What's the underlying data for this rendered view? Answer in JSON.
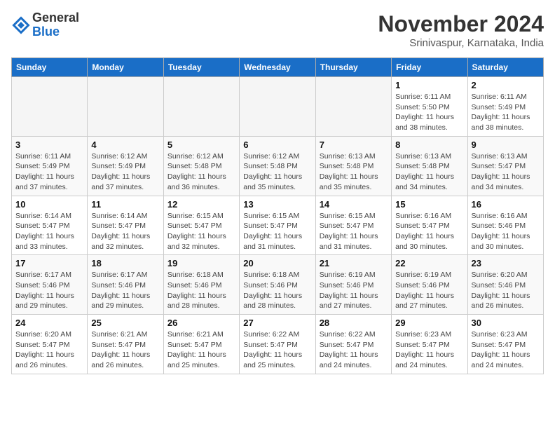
{
  "logo": {
    "general": "General",
    "blue": "Blue"
  },
  "title": "November 2024",
  "location": "Srinivaspur, Karnataka, India",
  "weekdays": [
    "Sunday",
    "Monday",
    "Tuesday",
    "Wednesday",
    "Thursday",
    "Friday",
    "Saturday"
  ],
  "weeks": [
    [
      {
        "day": "",
        "info": ""
      },
      {
        "day": "",
        "info": ""
      },
      {
        "day": "",
        "info": ""
      },
      {
        "day": "",
        "info": ""
      },
      {
        "day": "",
        "info": ""
      },
      {
        "day": "1",
        "info": "Sunrise: 6:11 AM\nSunset: 5:50 PM\nDaylight: 11 hours and 38 minutes."
      },
      {
        "day": "2",
        "info": "Sunrise: 6:11 AM\nSunset: 5:49 PM\nDaylight: 11 hours and 38 minutes."
      }
    ],
    [
      {
        "day": "3",
        "info": "Sunrise: 6:11 AM\nSunset: 5:49 PM\nDaylight: 11 hours and 37 minutes."
      },
      {
        "day": "4",
        "info": "Sunrise: 6:12 AM\nSunset: 5:49 PM\nDaylight: 11 hours and 37 minutes."
      },
      {
        "day": "5",
        "info": "Sunrise: 6:12 AM\nSunset: 5:48 PM\nDaylight: 11 hours and 36 minutes."
      },
      {
        "day": "6",
        "info": "Sunrise: 6:12 AM\nSunset: 5:48 PM\nDaylight: 11 hours and 35 minutes."
      },
      {
        "day": "7",
        "info": "Sunrise: 6:13 AM\nSunset: 5:48 PM\nDaylight: 11 hours and 35 minutes."
      },
      {
        "day": "8",
        "info": "Sunrise: 6:13 AM\nSunset: 5:48 PM\nDaylight: 11 hours and 34 minutes."
      },
      {
        "day": "9",
        "info": "Sunrise: 6:13 AM\nSunset: 5:47 PM\nDaylight: 11 hours and 34 minutes."
      }
    ],
    [
      {
        "day": "10",
        "info": "Sunrise: 6:14 AM\nSunset: 5:47 PM\nDaylight: 11 hours and 33 minutes."
      },
      {
        "day": "11",
        "info": "Sunrise: 6:14 AM\nSunset: 5:47 PM\nDaylight: 11 hours and 32 minutes."
      },
      {
        "day": "12",
        "info": "Sunrise: 6:15 AM\nSunset: 5:47 PM\nDaylight: 11 hours and 32 minutes."
      },
      {
        "day": "13",
        "info": "Sunrise: 6:15 AM\nSunset: 5:47 PM\nDaylight: 11 hours and 31 minutes."
      },
      {
        "day": "14",
        "info": "Sunrise: 6:15 AM\nSunset: 5:47 PM\nDaylight: 11 hours and 31 minutes."
      },
      {
        "day": "15",
        "info": "Sunrise: 6:16 AM\nSunset: 5:47 PM\nDaylight: 11 hours and 30 minutes."
      },
      {
        "day": "16",
        "info": "Sunrise: 6:16 AM\nSunset: 5:46 PM\nDaylight: 11 hours and 30 minutes."
      }
    ],
    [
      {
        "day": "17",
        "info": "Sunrise: 6:17 AM\nSunset: 5:46 PM\nDaylight: 11 hours and 29 minutes."
      },
      {
        "day": "18",
        "info": "Sunrise: 6:17 AM\nSunset: 5:46 PM\nDaylight: 11 hours and 29 minutes."
      },
      {
        "day": "19",
        "info": "Sunrise: 6:18 AM\nSunset: 5:46 PM\nDaylight: 11 hours and 28 minutes."
      },
      {
        "day": "20",
        "info": "Sunrise: 6:18 AM\nSunset: 5:46 PM\nDaylight: 11 hours and 28 minutes."
      },
      {
        "day": "21",
        "info": "Sunrise: 6:19 AM\nSunset: 5:46 PM\nDaylight: 11 hours and 27 minutes."
      },
      {
        "day": "22",
        "info": "Sunrise: 6:19 AM\nSunset: 5:46 PM\nDaylight: 11 hours and 27 minutes."
      },
      {
        "day": "23",
        "info": "Sunrise: 6:20 AM\nSunset: 5:46 PM\nDaylight: 11 hours and 26 minutes."
      }
    ],
    [
      {
        "day": "24",
        "info": "Sunrise: 6:20 AM\nSunset: 5:47 PM\nDaylight: 11 hours and 26 minutes."
      },
      {
        "day": "25",
        "info": "Sunrise: 6:21 AM\nSunset: 5:47 PM\nDaylight: 11 hours and 26 minutes."
      },
      {
        "day": "26",
        "info": "Sunrise: 6:21 AM\nSunset: 5:47 PM\nDaylight: 11 hours and 25 minutes."
      },
      {
        "day": "27",
        "info": "Sunrise: 6:22 AM\nSunset: 5:47 PM\nDaylight: 11 hours and 25 minutes."
      },
      {
        "day": "28",
        "info": "Sunrise: 6:22 AM\nSunset: 5:47 PM\nDaylight: 11 hours and 24 minutes."
      },
      {
        "day": "29",
        "info": "Sunrise: 6:23 AM\nSunset: 5:47 PM\nDaylight: 11 hours and 24 minutes."
      },
      {
        "day": "30",
        "info": "Sunrise: 6:23 AM\nSunset: 5:47 PM\nDaylight: 11 hours and 24 minutes."
      }
    ]
  ]
}
